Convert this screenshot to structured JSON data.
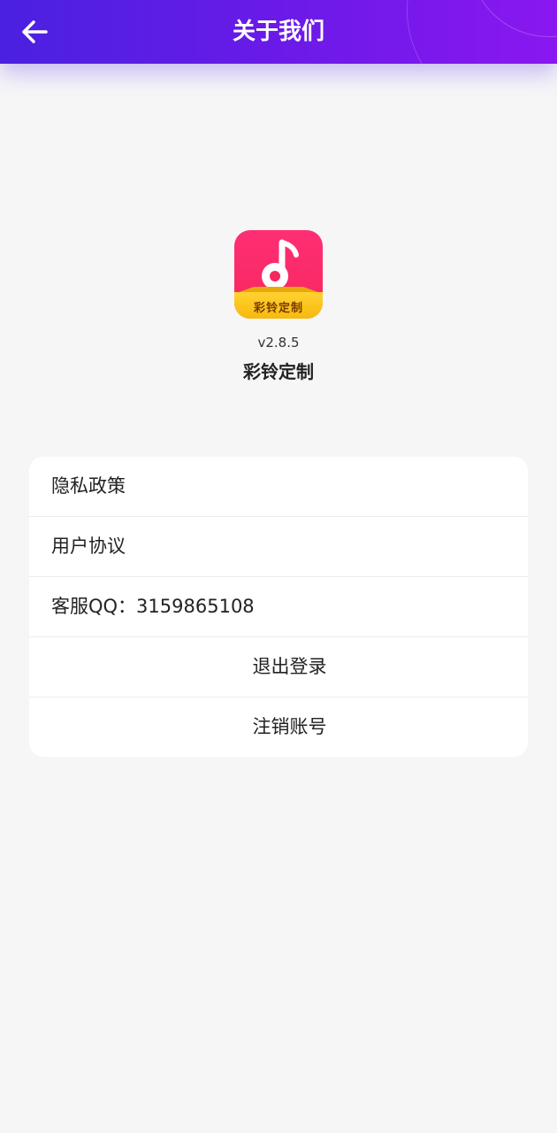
{
  "header": {
    "title": "关于我们",
    "back_icon": "arrow-left-icon",
    "gradient_start": "#4a21e0",
    "gradient_end": "#8a17f0"
  },
  "app": {
    "logo_icon": "music-note-icon",
    "logo_text": "彩铃定制",
    "version": "v2.8.5",
    "name": "彩铃定制"
  },
  "menu": {
    "privacy": "隐私政策",
    "agreement": "用户协议",
    "service_qq": "客服QQ：3159865108",
    "logout": "退出登录",
    "delete_account": "注销账号"
  }
}
